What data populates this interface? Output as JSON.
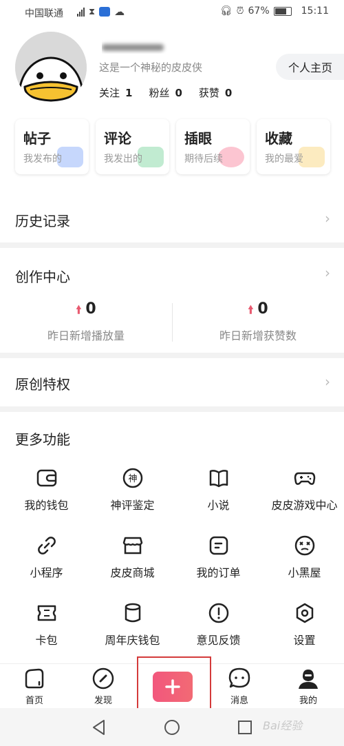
{
  "status_bar": {
    "carrier": "中国联通",
    "battery": "67%",
    "time": "15:11"
  },
  "profile": {
    "bio": "这是一个神秘的皮皮侠",
    "homepage_button": "个人主页",
    "stats": [
      {
        "label": "关注",
        "value": "1"
      },
      {
        "label": "粉丝",
        "value": "0"
      },
      {
        "label": "获赞",
        "value": "0"
      }
    ]
  },
  "cards": [
    {
      "title": "帖子",
      "subtitle": "我发布的",
      "color": "#5b8cf5"
    },
    {
      "title": "评论",
      "subtitle": "我发出的",
      "color": "#4cc77a"
    },
    {
      "title": "插眼",
      "subtitle": "期待后续",
      "color": "#f5597a"
    },
    {
      "title": "收藏",
      "subtitle": "我的最爱",
      "color": "#f7c64a"
    }
  ],
  "history": {
    "label": "历史记录"
  },
  "creation": {
    "label": "创作中心",
    "stats": [
      {
        "value": "0",
        "label": "昨日新增播放量"
      },
      {
        "value": "0",
        "label": "昨日新增获赞数"
      }
    ]
  },
  "original": {
    "label": "原创特权"
  },
  "more": {
    "title": "更多功能",
    "items": [
      {
        "label": "我的钱包",
        "icon": "wallet-icon"
      },
      {
        "label": "神评鉴定",
        "icon": "divine-comment-icon"
      },
      {
        "label": "小说",
        "icon": "book-icon"
      },
      {
        "label": "皮皮游戏中心",
        "icon": "gamepad-icon"
      },
      {
        "label": "小程序",
        "icon": "link-icon"
      },
      {
        "label": "皮皮商城",
        "icon": "store-icon"
      },
      {
        "label": "我的订单",
        "icon": "order-icon"
      },
      {
        "label": "小黑屋",
        "icon": "dizzy-face-icon"
      },
      {
        "label": "卡包",
        "icon": "ticket-icon"
      },
      {
        "label": "周年庆钱包",
        "icon": "cylinder-icon"
      },
      {
        "label": "意见反馈",
        "icon": "exclamation-icon"
      },
      {
        "label": "设置",
        "icon": "settings-icon"
      }
    ],
    "divine_glyph": "神"
  },
  "tabbar": {
    "items": [
      {
        "label": "首页",
        "icon": "home-icon"
      },
      {
        "label": "发现",
        "icon": "compass-icon"
      },
      {
        "label": "消息",
        "icon": "message-icon"
      },
      {
        "label": "我的",
        "icon": "profile-icon"
      }
    ],
    "accent": "#f2577d"
  },
  "watermark": "Bai经验"
}
